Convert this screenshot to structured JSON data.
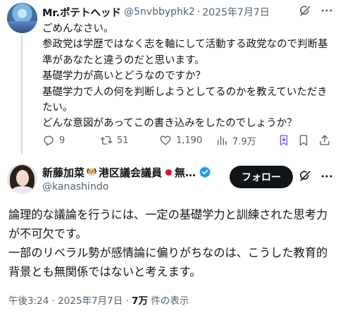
{
  "reply": {
    "author_name": "Mr.ポテトヘッド",
    "handle": "@5nvbbyphk2",
    "separator": "·",
    "date": "2025年7月7日",
    "lines": [
      "ごめんなさい。",
      "参政党は学歴ではなく志を軸にして活動する政党なので判断基準があなたと違うのだと思います。",
      "基礎学力が高いとどうなのですか？",
      "基礎学力で人の何を判断しようとしてるのかを教えていただきたい。",
      "どんな意図があってこの書き込みをしたのでしょうか？"
    ],
    "actions": {
      "replies": "9",
      "reposts": "51",
      "likes": "1,190",
      "views": "7.9万"
    }
  },
  "main": {
    "author_name": "新藤加菜",
    "author_name_tail": "港区議会議員",
    "author_name_ellipsis": "無…",
    "handle": "@kanashindo",
    "follow_label": "フォロー",
    "lines": [
      "論理的な議論を行うには、一定の基礎学力と訓練された思考力が不可欠です。",
      "一部のリベラル勢が感情論に偏りがちなのは、こうした教育的背景とも無関係ではないと考えます。"
    ],
    "time": "午後3:24",
    "separator": "·",
    "date": "2025年7月7日",
    "separator2": "·",
    "views": "7万",
    "views_suffix": " 件の表示"
  },
  "colors": {
    "text": "#0f1419",
    "muted": "#536471",
    "verified": "#1d9bf0",
    "follow_bg": "#0f1419",
    "red_dot": "#e0101f"
  },
  "icons": [
    "reply-icon",
    "repost-icon",
    "like-icon",
    "views-icon",
    "grok-icon",
    "more-icon",
    "bookmark-icon",
    "share-icon",
    "verified-icon",
    "dog-emoji-icon",
    "red-circle-icon"
  ]
}
